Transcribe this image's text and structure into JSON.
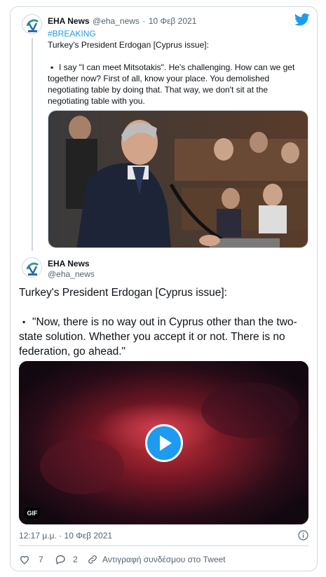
{
  "colors": {
    "accent": "#1d9bf0",
    "border": "#cfd9de",
    "muted": "#536471"
  },
  "quoted_tweet": {
    "author_name": "EHA News",
    "handle": "@eha_news",
    "date": "10 Φεβ 2021",
    "hashtag": "#BREAKING",
    "headline": "Turkey's President Erdogan [Cyprus issue]:",
    "quote_bullet": "▪",
    "quote_line1": "I say \"I can meet Mitsotakis\". He's challenging. How can we get",
    "quote_line2": "together now? First of all, know your place. You demolished",
    "quote_line3": "negotiating table by doing that. That way, we don't sit at the",
    "quote_line4": "negotiating table with you."
  },
  "main_tweet": {
    "author_name": "EHA News",
    "handle": "@eha_news",
    "headline": "Turkey's President Erdogan [Cyprus issue]:",
    "bullet": "▪",
    "line1": "\"Now, there is no way out in Cyprus other than the two-",
    "line2": "state solution. Whether you accept it or not. There is no",
    "line3": "federation, go ahead.\"",
    "media_badge": "GIF",
    "timestamp": "12:17 μ.μ. · 10 Φεβ 2021"
  },
  "actions": {
    "likes": "7",
    "replies": "2",
    "copy_link": "Αντιγραφή συνδέσμου στο Tweet"
  },
  "icons": [
    "twitter-bird-icon",
    "info-icon",
    "heart-icon",
    "reply-icon",
    "link-icon",
    "play-icon"
  ]
}
